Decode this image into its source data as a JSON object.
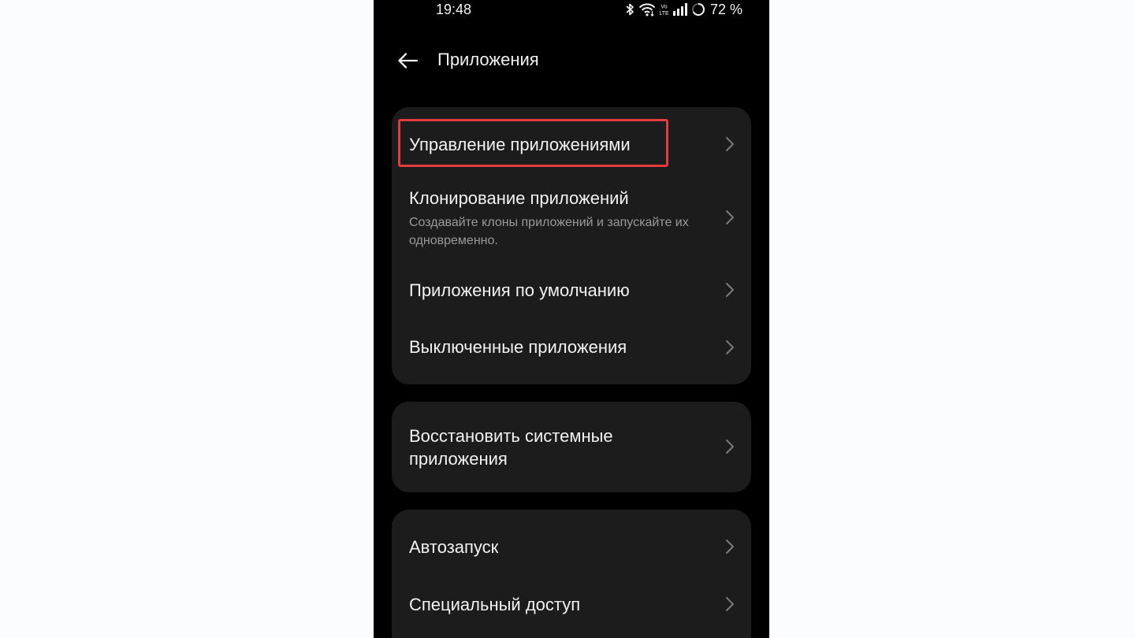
{
  "status_bar": {
    "time": "19:48",
    "battery": "72 %",
    "icons": [
      "bluetooth-icon",
      "wifi-icon",
      "volte-icon",
      "signal-icon",
      "battery-ring-icon"
    ]
  },
  "header": {
    "title": "Приложения",
    "back_icon": "arrow-left-icon"
  },
  "sections": [
    {
      "items": [
        {
          "title": "Управление приложениями",
          "highlighted": true
        },
        {
          "title": "Клонирование приложений",
          "subtitle": "Создавайте клоны приложений и запускайте их одновременно."
        },
        {
          "title": "Приложения по умолчанию"
        },
        {
          "title": "Выключенные приложения"
        }
      ]
    },
    {
      "items": [
        {
          "title": "Восстановить системные приложения"
        }
      ]
    },
    {
      "items": [
        {
          "title": "Автозапуск"
        },
        {
          "title": "Специальный доступ"
        }
      ]
    }
  ],
  "colors": {
    "page_background": "#fbfcfe",
    "screen_background": "#000000",
    "card_background": "#1c1c1c",
    "highlight": "#e23c3c",
    "text_primary": "#f2f2f2",
    "text_secondary": "#9a9a9a"
  }
}
